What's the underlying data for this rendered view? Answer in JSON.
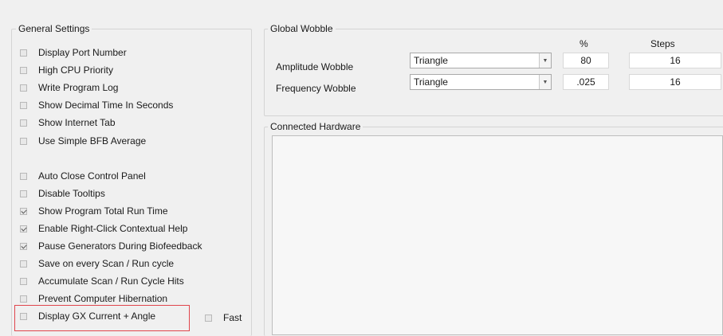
{
  "general_settings": {
    "title": "General Settings",
    "items": [
      {
        "label": "Display Port Number",
        "checked": false
      },
      {
        "label": "High CPU Priority",
        "checked": false
      },
      {
        "label": "Write Program Log",
        "checked": false
      },
      {
        "label": "Show Decimal Time In Seconds",
        "checked": false
      },
      {
        "label": "Show Internet Tab",
        "checked": false
      },
      {
        "label": "Use Simple BFB Average",
        "checked": false
      },
      {
        "label": "Auto Close Control Panel",
        "checked": false
      },
      {
        "label": "Disable Tooltips",
        "checked": false
      },
      {
        "label": "Show Program Total Run Time",
        "checked": true
      },
      {
        "label": "Enable Right-Click Contextual Help",
        "checked": true
      },
      {
        "label": "Pause Generators During Biofeedback",
        "checked": true
      },
      {
        "label": "Save on every Scan / Run cycle",
        "checked": false
      },
      {
        "label": "Accumulate Scan / Run Cycle Hits",
        "checked": false
      },
      {
        "label": "Prevent Computer Hibernation",
        "checked": false
      },
      {
        "label": "Display GX Current + Angle",
        "checked": false
      }
    ],
    "fast": {
      "label": "Fast",
      "checked": false
    }
  },
  "global_wobble": {
    "title": "Global Wobble",
    "col_percent": "%",
    "col_steps": "Steps",
    "rows": [
      {
        "label": "Amplitude Wobble",
        "type": "Triangle",
        "percent": "80",
        "steps": "16"
      },
      {
        "label": "Frequency Wobble",
        "type": "Triangle",
        "percent": ".025",
        "steps": "16"
      }
    ]
  },
  "connected_hardware": {
    "title": "Connected Hardware"
  },
  "colors": {
    "highlight": "#e0454c"
  }
}
